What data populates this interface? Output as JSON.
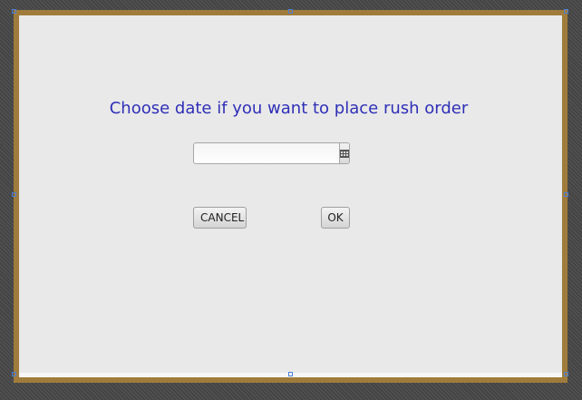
{
  "dialog": {
    "prompt": "Choose date if you want to place rush order",
    "date_field": {
      "value": "",
      "placeholder": ""
    },
    "calendar_button_icon": "calendar-icon",
    "cancel_label": "CANCEL",
    "ok_label": "OK"
  },
  "colors": {
    "frame_border": "#a07c3c",
    "panel_background": "#e9e9e9",
    "prompt_text": "#2f2fb8",
    "selection_handle": "#4d7fd4"
  }
}
